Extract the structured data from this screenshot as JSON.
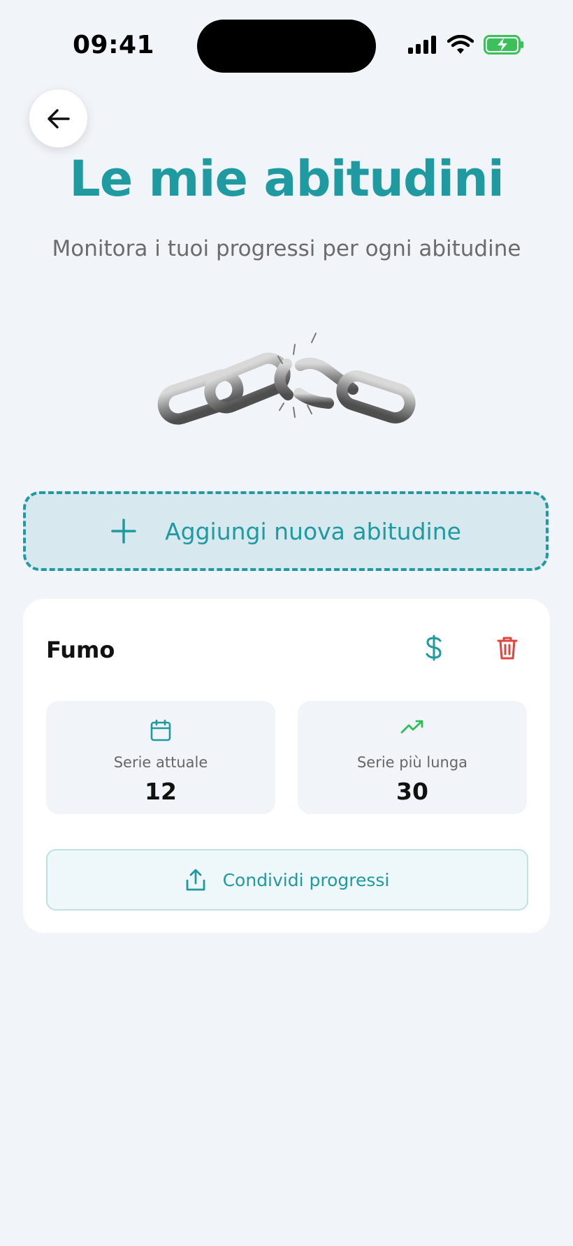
{
  "status_bar": {
    "time": "09:41"
  },
  "header": {
    "title": "Le mie abitudini",
    "subtitle": "Monitora i tuoi progressi per ogni abitudine"
  },
  "icons": {
    "back": "arrow-left-icon",
    "hero": "broken-chain-image",
    "add": "plus-icon",
    "dollar": "dollar-icon",
    "trash": "trash-icon",
    "calendar": "calendar-icon",
    "trend": "trending-up-icon",
    "share": "share-icon"
  },
  "actions": {
    "add_label": "Aggiungi nuova abitudine"
  },
  "habit": {
    "name": "Fumo",
    "current_streak_label": "Serie attuale",
    "current_streak_value": "12",
    "longest_streak_label": "Serie più lunga",
    "longest_streak_value": "30",
    "share_label": "Condividi progressi"
  },
  "colors": {
    "accent": "#1f9aa0",
    "danger": "#e0443e",
    "trend": "#2fbf5a",
    "background": "#f1f4f9"
  }
}
